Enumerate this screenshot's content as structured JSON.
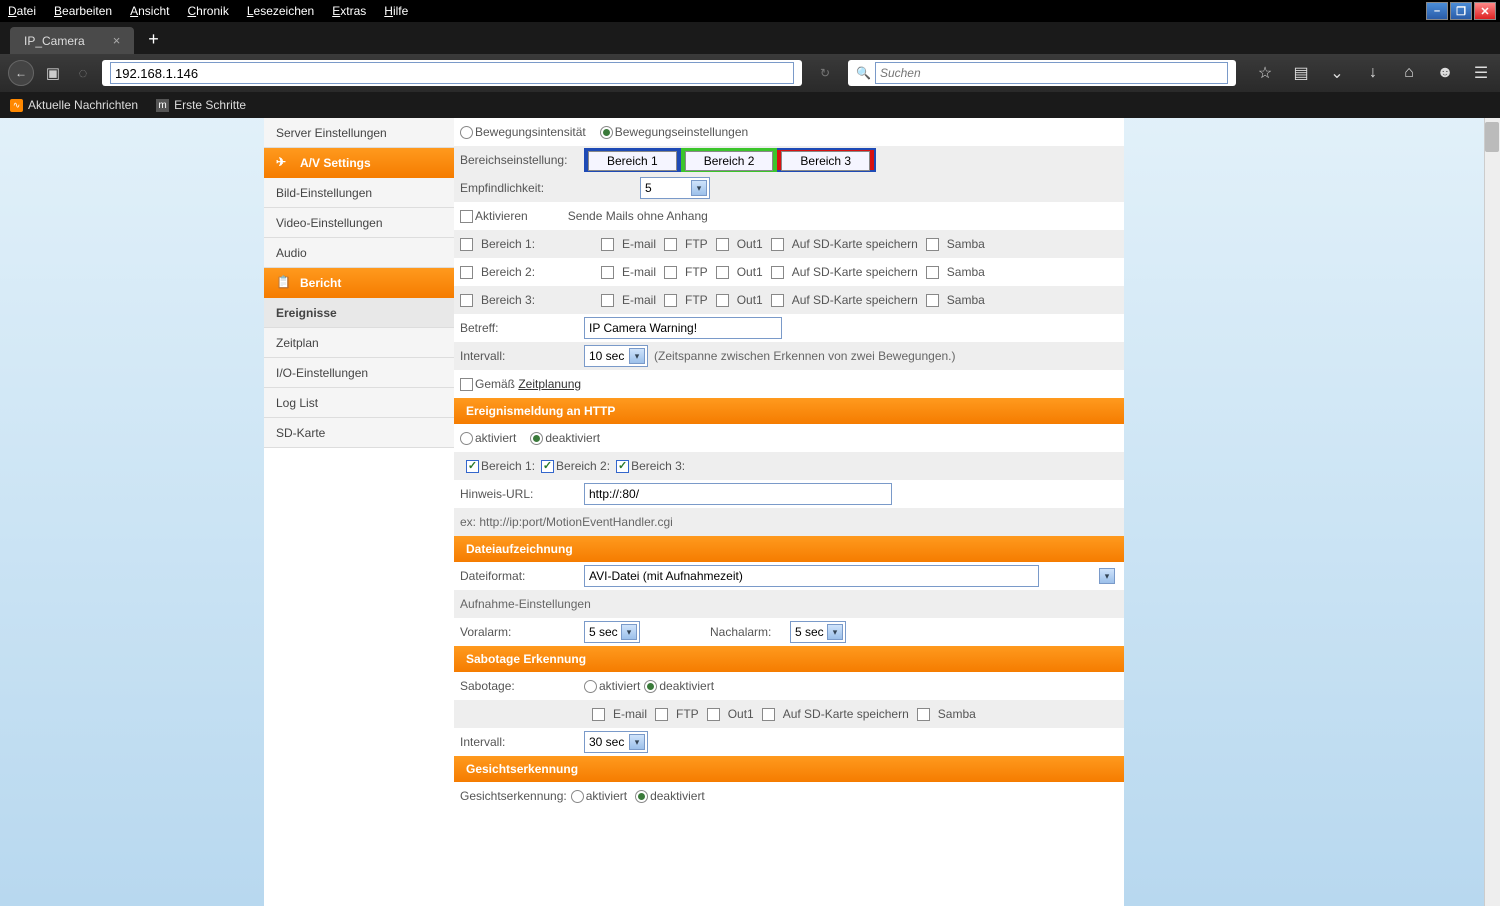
{
  "menubar": [
    "Datei",
    "Bearbeiten",
    "Ansicht",
    "Chronik",
    "Lesezeichen",
    "Extras",
    "Hilfe"
  ],
  "tab_title": "IP_Camera",
  "url": "192.168.1.146",
  "search_placeholder": "Suchen",
  "bookmarks": [
    "Aktuelle Nachrichten",
    "Erste Schritte"
  ],
  "sidebar": {
    "server_item": "Server Einstellungen",
    "av_header": "A/V Settings",
    "av_items": [
      "Bild-Einstellungen",
      "Video-Einstellungen",
      "Audio"
    ],
    "bericht_header": "Bericht",
    "bericht_items": [
      "Ereignisse",
      "Zeitplan",
      "I/O-Einstellungen",
      "Log List",
      "SD-Karte"
    ]
  },
  "motion": {
    "radio1": "Bewegungsintensität",
    "radio2": "Bewegungseinstellungen",
    "bereich_label": "Bereichseinstellung:",
    "b1": "Bereich 1",
    "b2": "Bereich 2",
    "b3": "Bereich 3",
    "sensitivity_label": "Empfindlichkeit:",
    "sensitivity_value": "5",
    "activate": "Aktivieren",
    "send_note": "Sende Mails ohne Anhang",
    "area1": "Bereich 1:",
    "area2": "Bereich 2:",
    "area3": "Bereich 3:",
    "opts": [
      "E-mail",
      "FTP",
      "Out1",
      "Auf SD-Karte speichern",
      "Samba"
    ],
    "subject_label": "Betreff:",
    "subject_value": "IP Camera Warning!",
    "interval_label": "Intervall:",
    "interval_value": "10 sec",
    "interval_note": "(Zeitspanne zwischen Erkennen von zwei Bewegungen.)",
    "schedule_pre": "Gemäß ",
    "schedule_link": "Zeitplanung"
  },
  "http": {
    "header": "Ereignismeldung an HTTP",
    "on": "aktiviert",
    "off": "deaktiviert",
    "b1": "Bereich 1:",
    "b2": "Bereich 2:",
    "b3": "Bereich 3:",
    "url_label": "Hinweis-URL:",
    "url_value": "http://:80/",
    "example": "ex: http://ip:port/MotionEventHandler.cgi"
  },
  "file": {
    "header": "Dateiaufzeichnung",
    "format_label": "Dateiformat:",
    "format_value": "AVI-Datei (mit Aufnahmezeit)",
    "rec_settings": "Aufnahme-Einstellungen",
    "pre_label": "Voralarm:",
    "pre_value": "5 sec",
    "post_label": "Nachalarm:",
    "post_value": "5 sec"
  },
  "sabotage": {
    "header": "Sabotage Erkennung",
    "label": "Sabotage:",
    "on": "aktiviert",
    "off": "deaktiviert",
    "opts": [
      "E-mail",
      "FTP",
      "Out1",
      "Auf SD-Karte speichern",
      "Samba"
    ],
    "interval_label": "Intervall:",
    "interval_value": "30 sec"
  },
  "face": {
    "header": "Gesichtserkennung",
    "label": "Gesichtserkennung:",
    "on": " aktiviert",
    "off": " deaktiviert"
  }
}
